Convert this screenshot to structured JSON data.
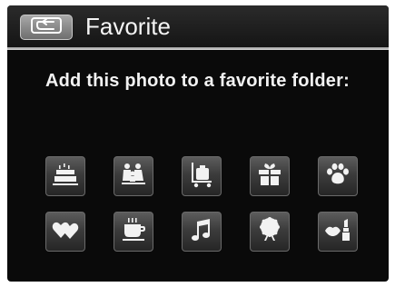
{
  "header": {
    "back_icon": "back-arrow-icon",
    "title": "Favorite"
  },
  "prompt": "Add this photo to a favorite folder:",
  "folders": [
    {
      "icon": "birthday-cake-icon"
    },
    {
      "icon": "family-icon"
    },
    {
      "icon": "luggage-cart-icon"
    },
    {
      "icon": "gift-icon"
    },
    {
      "icon": "paw-print-icon"
    },
    {
      "icon": "hearts-icon"
    },
    {
      "icon": "coffee-cup-icon"
    },
    {
      "icon": "music-note-icon"
    },
    {
      "icon": "ferris-wheel-icon"
    },
    {
      "icon": "lips-lipstick-icon"
    }
  ],
  "colors": {
    "background": "#0a0a0a",
    "text": "#f2f2f2",
    "tile": "#3c3c3c",
    "header_line": "#c8c8c8"
  }
}
